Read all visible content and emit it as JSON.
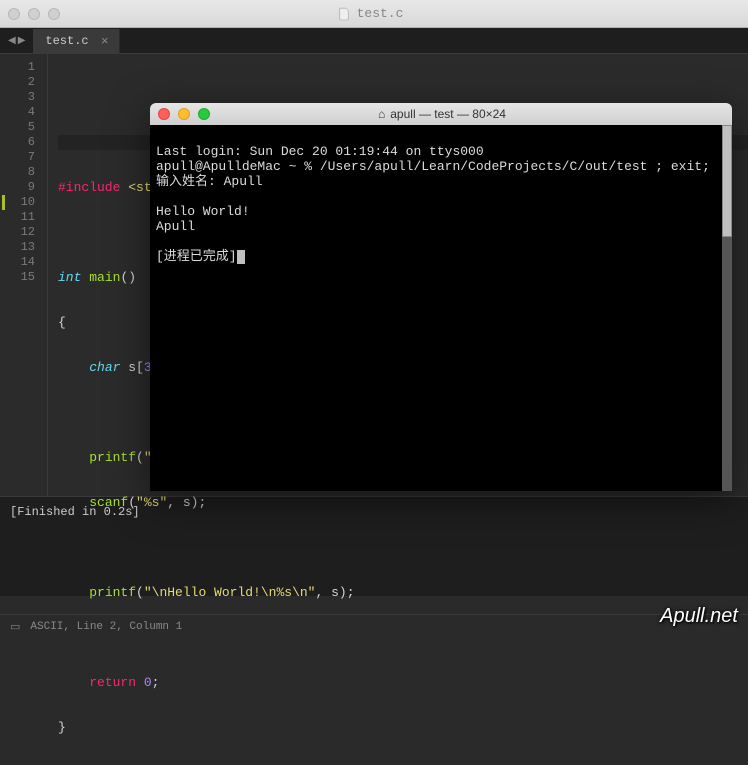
{
  "titlebar": {
    "filename": "test.c"
  },
  "tabs": {
    "nav_prev": "◀",
    "nav_next": "▶",
    "active": "test.c",
    "close": "×"
  },
  "gutter": [
    "1",
    "2",
    "3",
    "4",
    "5",
    "6",
    "7",
    "8",
    "9",
    "10",
    "11",
    "12",
    "13",
    "14",
    "15"
  ],
  "code": {
    "l3_inc": "#include",
    "l3_hdr": "<stdio.h>",
    "l5_int": "int",
    "l5_main": "main",
    "l5_paren": "()",
    "l6": "{",
    "l7_char": "char",
    "l7_s": "s[",
    "l7_num": "30",
    "l7_end": "];",
    "l9_fn": "printf",
    "l9_p1": "(",
    "l9_str": "\"输入姓名：\"",
    "l9_p2": ");",
    "l10_fn": "scanf",
    "l10_p1": "(",
    "l10_str": "\"%s\"",
    "l10_p2": ", s);",
    "l12_fn": "printf",
    "l12_p1": "(",
    "l12_str": "\"\\nHello World!\\n%s\\n\"",
    "l12_p2": ", s);",
    "l14_ret": "return",
    "l14_num": "0",
    "l14_end": ";",
    "l15": "}"
  },
  "output": {
    "status": "[Finished in 0.2s]"
  },
  "statusbar": {
    "text": "ASCII, Line 2, Column 1"
  },
  "terminal": {
    "title": "apull — test — 80×24",
    "lines": [
      "Last login: Sun Dec 20 01:19:44 on ttys000",
      "apull@ApulldeMac ~ % /Users/apull/Learn/CodeProjects/C/out/test ; exit;",
      "输入姓名: Apull",
      "",
      "Hello World!",
      "Apull",
      "",
      "[进程已完成]"
    ]
  },
  "watermark": "Apull.net"
}
